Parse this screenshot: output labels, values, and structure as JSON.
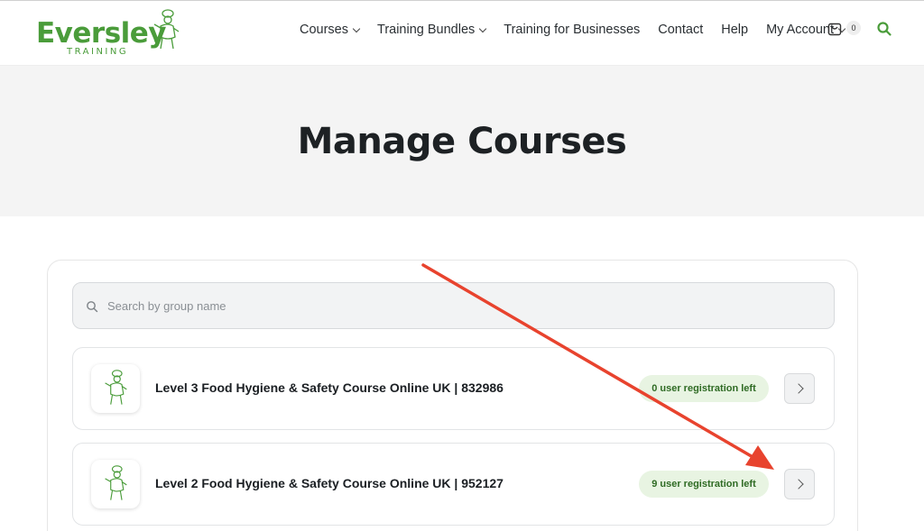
{
  "logo": {
    "word": "Eversley",
    "sub": "TRAINING"
  },
  "nav": {
    "items": [
      {
        "label": "Courses",
        "dropdown": true
      },
      {
        "label": "Training Bundles",
        "dropdown": true
      },
      {
        "label": "Training for Businesses",
        "dropdown": false
      },
      {
        "label": "Contact",
        "dropdown": false
      },
      {
        "label": "Help",
        "dropdown": false
      },
      {
        "label": "My Account",
        "dropdown": true
      }
    ],
    "cart_count": "0",
    "search_icon": "search-icon"
  },
  "hero": {
    "title": "Manage Courses"
  },
  "search": {
    "placeholder": "Search by group name",
    "value": ""
  },
  "courses": [
    {
      "name": "Level 3 Food Hygiene & Safety Course Online UK | 832986",
      "badge": "0 user registration left"
    },
    {
      "name": "Level 2 Food Hygiene & Safety Course Online UK | 952127",
      "badge": "9 user registration left"
    }
  ],
  "colors": {
    "brand": "#4a9c3a",
    "badge_bg": "#e8f4e2",
    "badge_text": "#2f6b24",
    "annotation_arrow": "#e8432e"
  }
}
